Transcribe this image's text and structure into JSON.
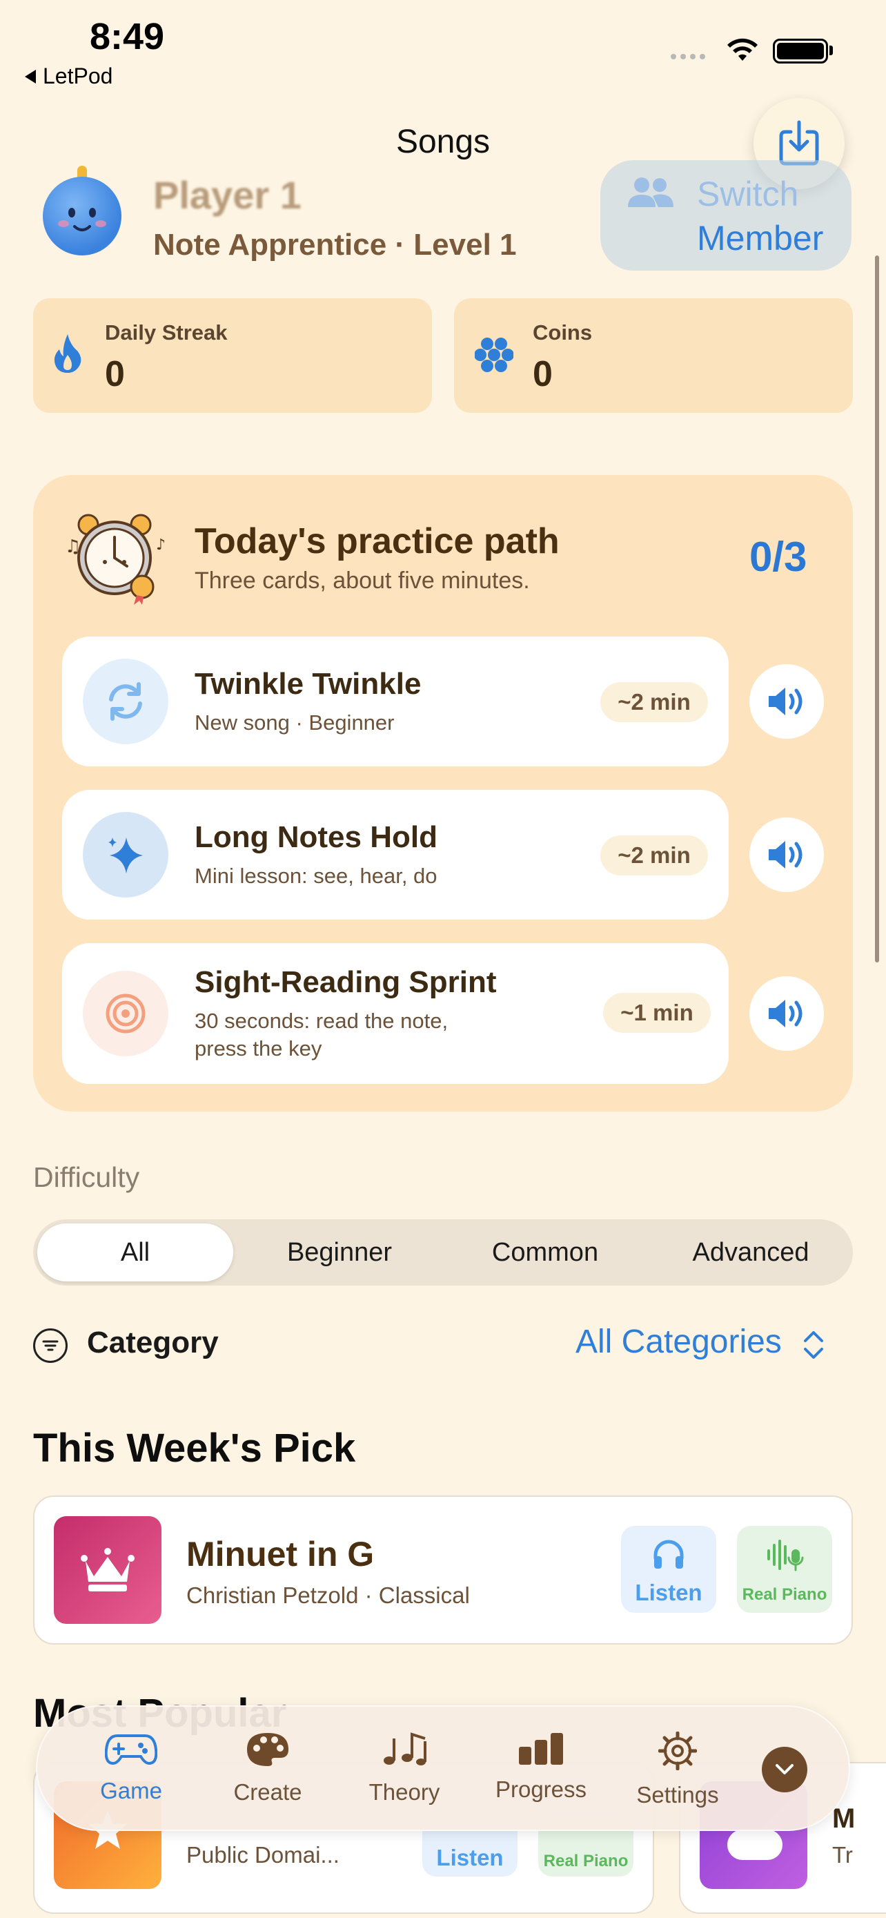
{
  "status_bar": {
    "time": "8:49",
    "back_app": "LetPod"
  },
  "nav": {
    "title": "Songs",
    "download_icon": "download-tray-icon"
  },
  "player": {
    "name": "Player 1",
    "level": "Note Apprentice · Level 1"
  },
  "switch_member": {
    "line1": "Switch",
    "line2": "Member"
  },
  "stats": [
    {
      "label": "Daily Streak",
      "value": "0",
      "icon": "flame-icon"
    },
    {
      "label": "Coins",
      "value": "0",
      "icon": "coins-icon"
    }
  ],
  "practice": {
    "title": "Today's practice path",
    "subtitle": "Three cards, about five minutes.",
    "progress": "0/3",
    "tasks": [
      {
        "title": "Twinkle Twinkle",
        "subtitle": "New song · Beginner",
        "duration": "~2 min",
        "icon": "refresh-icon"
      },
      {
        "title": "Long Notes Hold",
        "subtitle": "Mini lesson: see, hear, do",
        "duration": "~2 min",
        "icon": "sparkle-icon"
      },
      {
        "title": "Sight-Reading Sprint",
        "subtitle_line1": "30 seconds: read the note,",
        "subtitle_line2": "press the key",
        "duration": "~1 min",
        "icon": "target-icon"
      }
    ]
  },
  "difficulty": {
    "label": "Difficulty",
    "options": [
      "All",
      "Beginner",
      "Common",
      "Advanced"
    ],
    "selected": "All"
  },
  "category": {
    "label": "Category",
    "value": "All Categories"
  },
  "week_pick": {
    "heading": "This Week's Pick",
    "title": "Minuet in G",
    "subtitle": "Christian Petzold · Classical",
    "listen_label": "Listen",
    "piano_label": "Real Piano"
  },
  "popular": {
    "heading": "Most Popular",
    "card1_sub": "Public Domai...",
    "card1_listen": "Listen",
    "card1_piano": "Real Piano",
    "card2_title": "M",
    "card2_sub": "Tr"
  },
  "tabs": [
    {
      "label": "Game",
      "icon": "gamepad-icon",
      "active": true
    },
    {
      "label": "Create",
      "icon": "palette-icon",
      "active": false
    },
    {
      "label": "Theory",
      "icon": "music-notes-icon",
      "active": false
    },
    {
      "label": "Progress",
      "icon": "bar-chart-icon",
      "active": false
    },
    {
      "label": "Settings",
      "icon": "gear-icon",
      "active": false
    }
  ],
  "colors": {
    "accent": "#2F7ED8",
    "background": "#FDF4E3",
    "card": "#FBE3BD",
    "text": "#3D2A12"
  }
}
